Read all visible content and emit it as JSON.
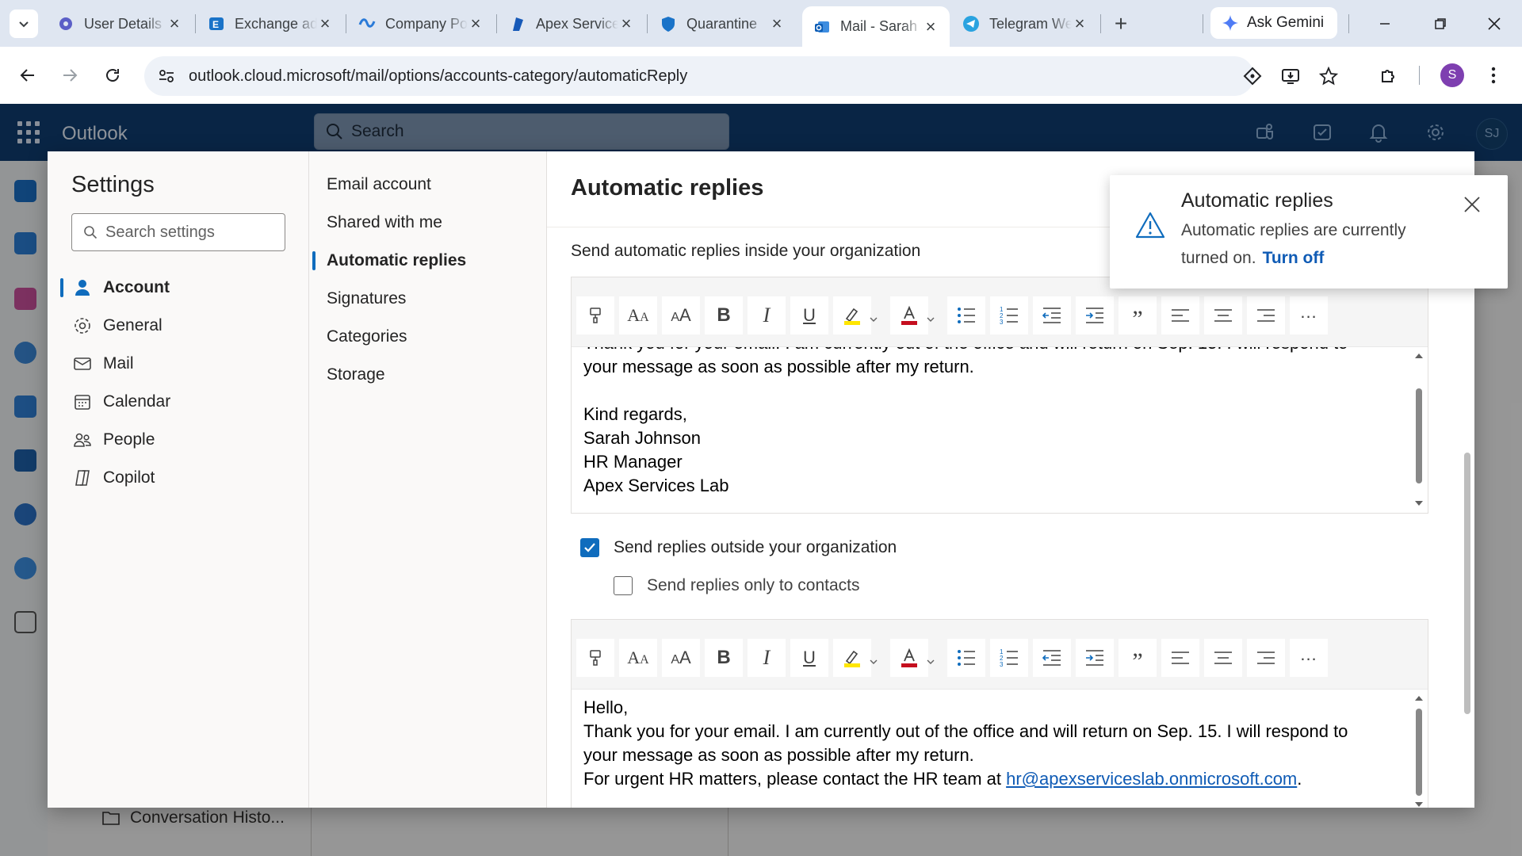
{
  "browser": {
    "tabs": [
      {
        "label": "User Details",
        "icon": "gear-badge-icon"
      },
      {
        "label": "Exchange admin center",
        "icon": "exchange-icon"
      },
      {
        "label": "Company Portal",
        "icon": "intune-icon"
      },
      {
        "label": "Apex Services",
        "icon": "sharepoint-icon"
      },
      {
        "label": "Quarantine",
        "icon": "defender-shield-icon"
      },
      {
        "label": "Mail - Sarah Johnson",
        "icon": "outlook-icon"
      },
      {
        "label": "Telegram Web",
        "icon": "telegram-icon"
      }
    ],
    "active_tab_index": 5,
    "gemini_label": "Ask Gemini",
    "url": "outlook.cloud.microsoft/mail/options/accounts-category/automaticReply",
    "profile_initial": "S"
  },
  "outlook": {
    "app_name": "Outlook",
    "search_placeholder": "Search",
    "avatar_initials": "SJ",
    "background_folder": "Conversation Histo..."
  },
  "settings": {
    "title": "Settings",
    "search_placeholder": "Search settings",
    "categories": [
      {
        "label": "Account",
        "icon": "person-icon"
      },
      {
        "label": "General",
        "icon": "gear-icon"
      },
      {
        "label": "Mail",
        "icon": "mail-icon"
      },
      {
        "label": "Calendar",
        "icon": "calendar-icon"
      },
      {
        "label": "People",
        "icon": "people-icon"
      },
      {
        "label": "Copilot",
        "icon": "copilot-icon"
      }
    ],
    "selected_category": "Account",
    "subcategories": [
      "Email account",
      "Shared with me",
      "Automatic replies",
      "Signatures",
      "Categories",
      "Storage"
    ],
    "selected_subcategory": "Automatic replies"
  },
  "auto_replies": {
    "title": "Automatic replies",
    "inside_label": "Send automatic replies inside your organization",
    "inside_message_lines": [
      "Thank you for your email. I am currently out of the office and will return on Sep. 15. I will respond to",
      "your message as soon as possible after my return.",
      "",
      "Kind regards,",
      "Sarah Johnson",
      "HR Manager",
      "Apex Services Lab"
    ],
    "outside_checkbox_label": "Send replies outside your organization",
    "outside_checked": true,
    "contacts_only_label": "Send replies only to contacts",
    "contacts_only_checked": false,
    "outside_message": {
      "line1": "Hello,",
      "line2": "Thank you for your email. I am currently out of the office and will return on Sep. 15. I will respond to",
      "line3": "your message as soon as possible after my return.",
      "line4_prefix": "For urgent HR matters, please contact the HR team at ",
      "line4_link": "hr@apexserviceslab.onmicrosoft.com",
      "line4_suffix": "."
    }
  },
  "toast": {
    "title": "Automatic replies",
    "message": "Automatic replies are currently turned on.",
    "action": "Turn off"
  },
  "colors": {
    "accent": "#0f6cbd",
    "header": "#0f3d70",
    "highlight": "#ffe600",
    "font_color": "#c50f1f",
    "link": "#0f5bb5"
  }
}
